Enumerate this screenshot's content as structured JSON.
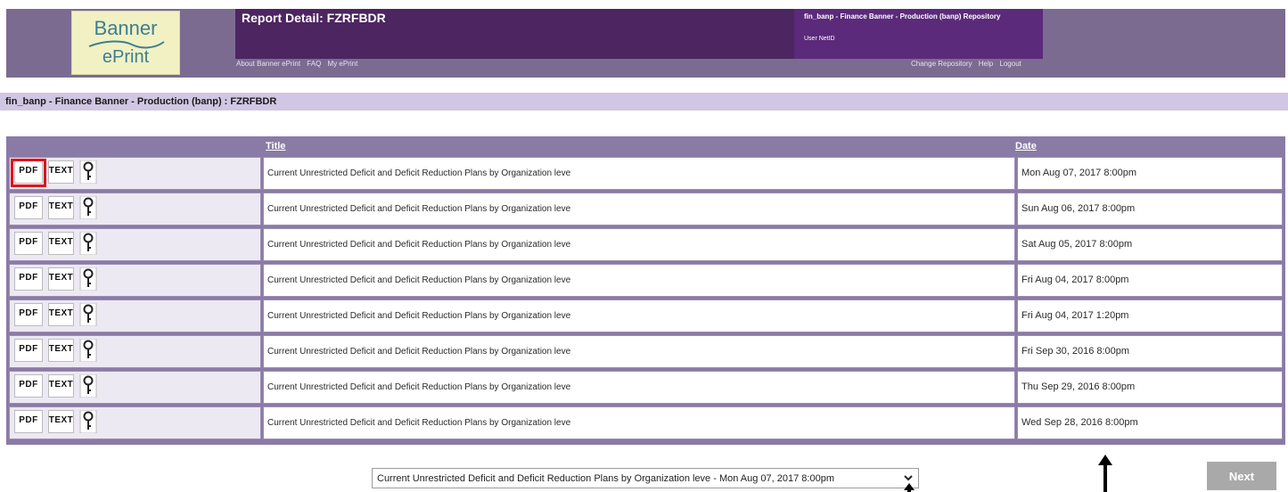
{
  "header": {
    "logo_line1": "Banner",
    "logo_line2": "ePrint",
    "report_title": "Report Detail: FZRFBDR",
    "repository_name": "fin_banp - Finance Banner - Production (banp) Repository",
    "user_netid_label": "User NetID",
    "nav_left": [
      "About Banner ePrint",
      "FAQ",
      "My ePrint"
    ],
    "nav_right": [
      "Change Repository",
      "Help",
      "Logout"
    ]
  },
  "breadcrumb": "fin_banp - Finance Banner - Production (banp) : FZRFBDR",
  "table": {
    "col_title": "Title",
    "col_date": "Date",
    "icons": {
      "pdf": "PDF",
      "text": "TEXT",
      "key": "key-icon"
    },
    "rows": [
      {
        "title": "Current Unrestricted Deficit and Deficit Reduction Plans by Organization leve",
        "date": "Mon Aug 07, 2017 8:00pm"
      },
      {
        "title": "Current Unrestricted Deficit and Deficit Reduction Plans by Organization leve",
        "date": "Sun Aug 06, 2017 8:00pm"
      },
      {
        "title": "Current Unrestricted Deficit and Deficit Reduction Plans by Organization leve",
        "date": "Sat Aug 05, 2017 8:00pm"
      },
      {
        "title": "Current Unrestricted Deficit and Deficit Reduction Plans by Organization leve",
        "date": "Fri Aug 04, 2017 8:00pm"
      },
      {
        "title": "Current Unrestricted Deficit and Deficit Reduction Plans by Organization leve",
        "date": "Fri Aug 04, 2017 1:20pm"
      },
      {
        "title": "Current Unrestricted Deficit and Deficit Reduction Plans by Organization leve",
        "date": "Fri Sep 30, 2016 8:00pm"
      },
      {
        "title": "Current Unrestricted Deficit and Deficit Reduction Plans by Organization leve",
        "date": "Thu Sep 29, 2016 8:00pm"
      },
      {
        "title": "Current Unrestricted Deficit and Deficit Reduction Plans by Organization leve",
        "date": "Wed Sep 28, 2016 8:00pm"
      }
    ]
  },
  "selector": {
    "value": "Current Unrestricted Deficit and Deficit Reduction Plans by Organization leve - Mon Aug 07, 2017 8:00pm"
  },
  "next_label": "Next",
  "colors": {
    "header": "#7b6b91",
    "report_bar": "#4c2561",
    "breadcrumb": "#d1c6e3",
    "table_bg": "#8a7ba6",
    "highlight": "#e0141c"
  }
}
